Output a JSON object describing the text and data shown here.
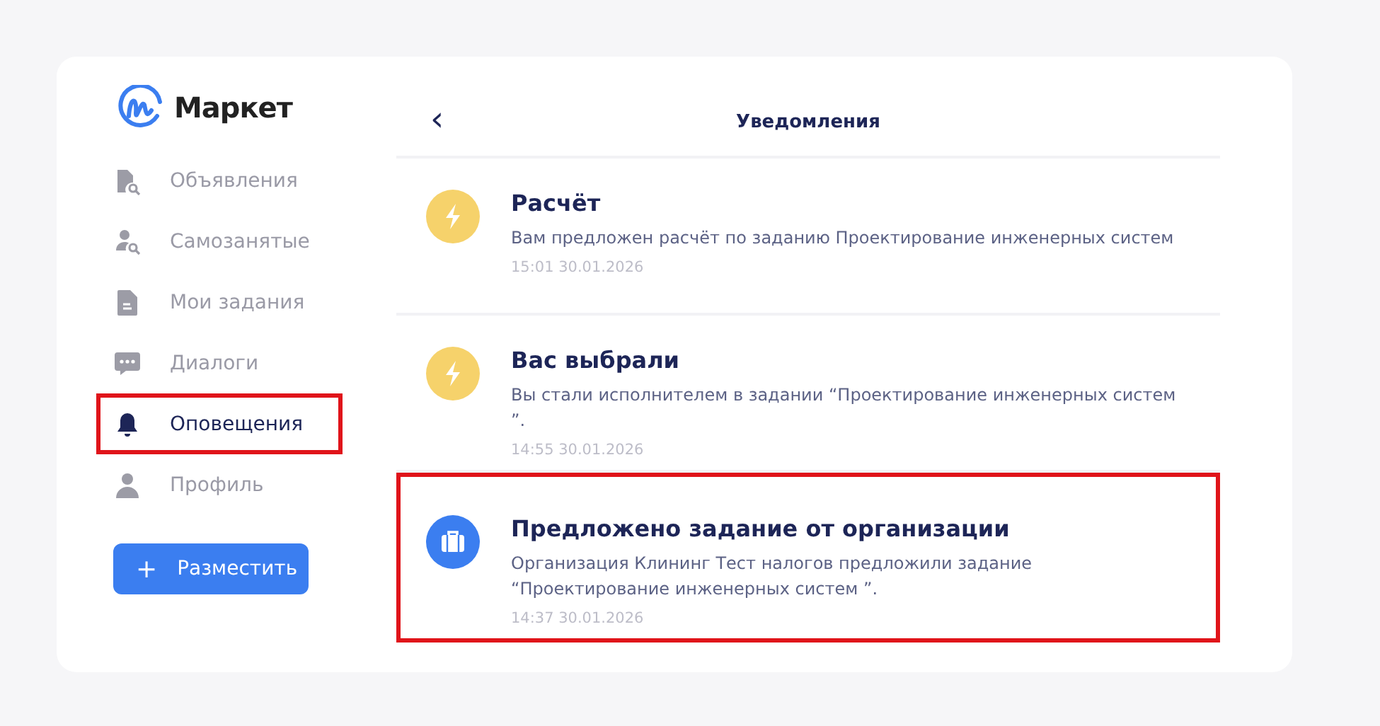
{
  "logo": {
    "text": "Маркет"
  },
  "nav": [
    {
      "label": "Объявления",
      "kind": "ads",
      "selected": false,
      "highlighted": false
    },
    {
      "label": "Самозанятые",
      "kind": "people",
      "selected": false,
      "highlighted": false
    },
    {
      "label": "Мои задания",
      "kind": "doc",
      "selected": false,
      "highlighted": false
    },
    {
      "label": "Диалоги",
      "kind": "chat",
      "selected": false,
      "highlighted": false
    },
    {
      "label": "Оповещения",
      "kind": "bell",
      "selected": true,
      "highlighted": true
    },
    {
      "label": "Профиль",
      "kind": "person",
      "selected": false,
      "highlighted": false
    }
  ],
  "post_button": {
    "icon": "+",
    "label": "Разместить"
  },
  "header": {
    "back": "‹",
    "title": "Уведомления"
  },
  "notifications": [
    {
      "kind": "lightning",
      "title": "Расчёт",
      "text": "Вам предложен расчёт по заданию Проектирование инженерных систем",
      "time": "15:01 30.01.2026",
      "highlighted": false
    },
    {
      "kind": "lightning",
      "title": "Вас выбрали",
      "text": "Вы стали исполнителем в задании “Проектирование инженерных систем ”.",
      "time": "14:55 30.01.2026",
      "highlighted": false
    },
    {
      "kind": "briefcase",
      "title": "Предложено задание от организации",
      "text": "Организация Клининг Тест налогов предложили задание “Проектирование инженерных систем ”.",
      "time": "14:37 30.01.2026",
      "highlighted": true
    }
  ]
}
